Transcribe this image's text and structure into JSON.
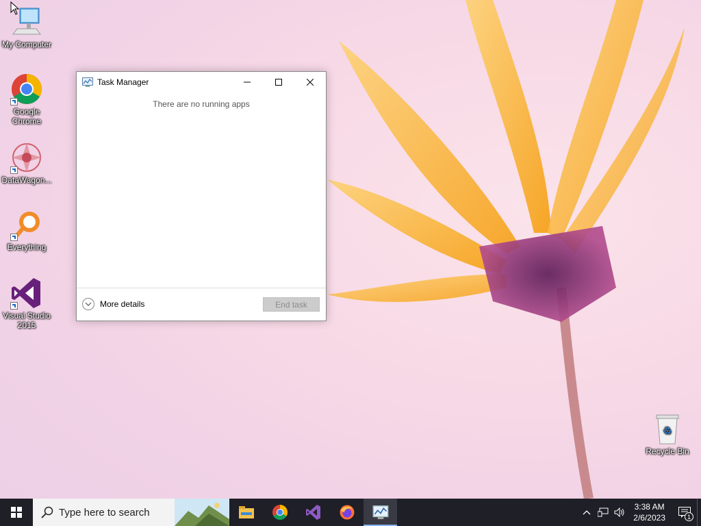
{
  "desktop": {
    "icons": [
      {
        "label": "My Computer"
      },
      {
        "label": "Google Chrome"
      },
      {
        "label": "DataWagon..."
      },
      {
        "label": "Everything"
      },
      {
        "label": "Visual Studio 2015"
      },
      {
        "label": "Recycle Bin"
      }
    ]
  },
  "task_manager": {
    "title": "Task Manager",
    "empty_message": "There are no running apps",
    "more_details_label": "More details",
    "end_task_label": "End task"
  },
  "taskbar": {
    "search_placeholder": "Type here to search",
    "pinned": [
      "file-explorer-icon",
      "chrome-icon",
      "visual-studio-icon",
      "firefox-icon",
      "task-manager-icon"
    ],
    "time": "3:38 AM",
    "date": "2/6/2023",
    "notification_count": "1"
  },
  "colors": {
    "taskbar_bg": "#1f1f27",
    "accent": "#8ab4f8"
  }
}
